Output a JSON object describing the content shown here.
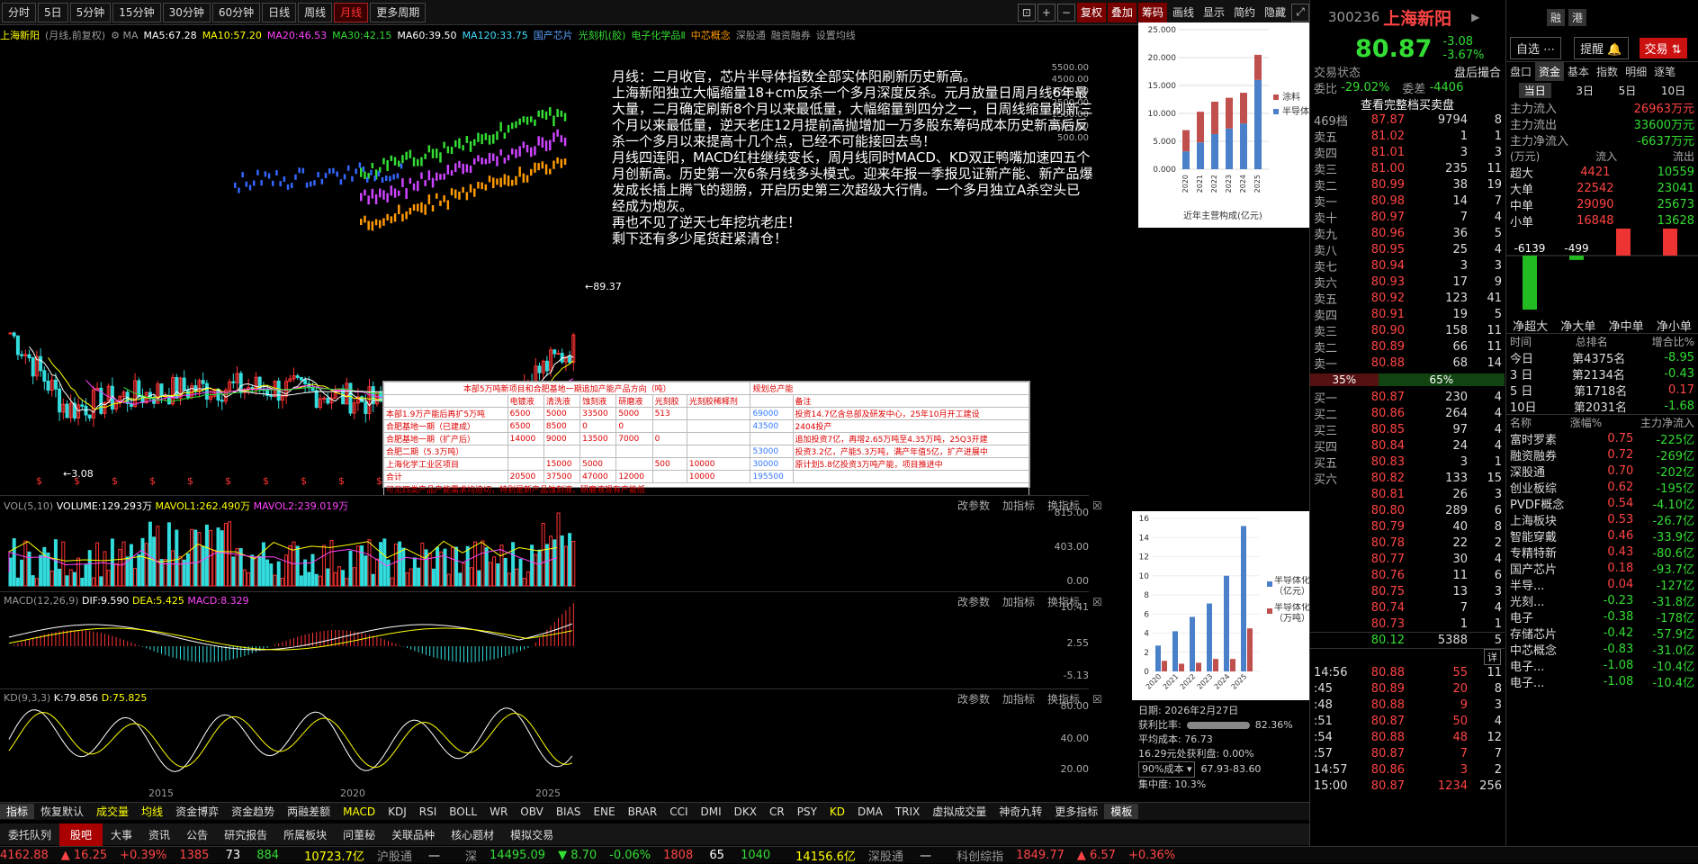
{
  "toolbar": {
    "periods": [
      "分时",
      "5日",
      "5分钟",
      "15分钟",
      "30分钟",
      "60分钟",
      "日线",
      "周线",
      "月线",
      "更多周期"
    ],
    "active_period": "月线",
    "right_buttons": [
      "复权",
      "叠加",
      "筹码",
      "画线",
      "显示",
      "简约",
      "隐藏"
    ]
  },
  "ma_line": {
    "name": "上海新阳",
    "mode": "(月线,前复权)",
    "ma5": "MA5:67.28",
    "ma10": "MA10:57.20",
    "ma20": "MA20:46.53",
    "ma30": "MA30:42.15",
    "ma60": "MA60:39.50",
    "ma120": "MA120:33.75",
    "tags": [
      "国产芯片",
      "光刻机(胶)",
      "电子化学品Ⅱ",
      "中芯概念"
    ],
    "links": [
      "深股通",
      "融资融券",
      "设置均线"
    ]
  },
  "annotation": "月线：二月收官，芯片半导体指数全部实体阳刷新历史新高。\n上海新阳独立大幅缩量18+cm反杀一个多月深度反杀。元月放量日周月线6年最大量，二月确定刷新8个月以来最低量，大幅缩量到四分之一，日周线缩量刷新三个月以来最低量，逆天老庄12月提前高抛增加一万多股东筹码成本历史新高后反杀一个多月以来提高十几个点，已经不可能接回去鸟！\n月线四连阳，MACD红柱继续变长，周月线同时MACD、KD双正鸭嘴加速四五个月创新高。历史第一次6条月线多头模式。迎来年报一季报见证新产能、新产品爆发成长插上腾飞的翅膀，开启历史第三次超级大行情。一个多月独立A杀空头已经成为炮灰。\n再也不见了逆天七年挖坑老庄！\n剩下还有多少尾货赶紧清仓！",
  "price_marks": {
    "high": "89.37",
    "low": "3.08"
  },
  "main_yaxis": [
    "5500.00",
    "4500.00",
    "3500.00",
    "2500.00",
    "1500.00",
    "1000.00",
    "500.00"
  ],
  "xaxis": [
    "2015",
    "2020",
    "2025"
  ],
  "table": {
    "title": "本部5万吨新项目和合肥基地一期追加产能产品方向（吨）",
    "title2": "规划总产能",
    "headers": [
      "",
      "电镀液",
      "清洗液",
      "蚀刻液",
      "研磨液",
      "光刻胶",
      "光刻胶稀释剂",
      "",
      "备注"
    ],
    "rows": [
      [
        "本部1.9万产能后再扩5万吨",
        "6500",
        "5000",
        "33500",
        "5000",
        "513",
        "",
        "69000",
        "投资14.7亿含总部及研发中心，25年10月开工建设"
      ],
      [
        "合肥基地一期（已建成）",
        "6500",
        "8500",
        "0",
        "0",
        "",
        "",
        "43500",
        "2404投产"
      ],
      [
        "合肥基地一期（扩产后）",
        "14000",
        "9000",
        "13500",
        "7000",
        "0",
        "",
        "",
        "追加投资7亿，再增2.65万吨至4.35万吨，25Q3开建"
      ],
      [
        "合肥二期（5.3万吨）",
        "",
        "",
        "",
        "",
        "",
        "",
        "53000",
        "投资3.2亿，产能5.3万吨，满产年值5亿，扩产进展中"
      ],
      [
        "上海化学工业区项目",
        "",
        "15000",
        "5000",
        "",
        "500",
        "10000",
        "30000",
        "原计划5.8亿投资3万吨产能，项目推进中"
      ],
      [
        "合计",
        "20500",
        "37500",
        "47000",
        "12000",
        "",
        "10000",
        "195500",
        ""
      ]
    ],
    "footer": "可见四类产品产能需求均迫切，特别是新产品蚀刻液、研磨液现有产能低"
  },
  "vol": {
    "label": "VOL(5,10)",
    "volume": "VOLUME:129.293万",
    "mavol1": "MAVOL1:262.490万",
    "mavol2": "MAVOL2:239.019万",
    "yaxis": [
      "815.00",
      "403.00",
      "0.00"
    ]
  },
  "macd": {
    "label": "MACD(12,26,9)",
    "dif": "DIF:9.590",
    "dea": "DEA:5.425",
    "macd": "MACD:8.329",
    "yaxis": [
      "10.41",
      "2.55",
      "-5.13"
    ]
  },
  "kd": {
    "label": "KD(9,3,3)",
    "k": "K:79.856",
    "d": "D:75.825",
    "yaxis": [
      "80.00",
      "40.00",
      "20.00"
    ]
  },
  "panel_tools": [
    "改参数",
    "加指标",
    "换指标"
  ],
  "info_box": {
    "date": "日期: 2026年2月27日",
    "profit_ratio_label": "获利比率:",
    "profit_ratio": "82.36%",
    "avg_cost": "平均成本: 76.73",
    "profit_at": "16.29元处获利盘: 0.00%",
    "cost_select": "90%成本",
    "cost_range": "67.93-83.60",
    "concentration": "集中度: 10.3%"
  },
  "mini1": {
    "yaxis": [
      "25.000",
      "20.000",
      "15.000",
      "10.000",
      "5.000",
      "0.000"
    ],
    "years": [
      "2020",
      "2021",
      "2022",
      "2023",
      "2024",
      "2025"
    ],
    "legend1": "涂料",
    "legend2": "半导体",
    "caption": "近年主营构成(亿元)"
  },
  "mini2": {
    "yaxis": [
      "16",
      "14",
      "12",
      "10",
      "8",
      "6",
      "4",
      "2",
      "0"
    ],
    "years": [
      "2020",
      "2021",
      "2022",
      "2023",
      "2024",
      "2025"
    ],
    "legend1": "半导体化学品营收（亿元）",
    "legend2": "半导体化学品产出（万吨）"
  },
  "chart_data": [
    {
      "type": "bar",
      "title": "近年主营构成(亿元)",
      "categories": [
        "2020",
        "2021",
        "2022",
        "2023",
        "2024",
        "2025"
      ],
      "series": [
        {
          "name": "半导体",
          "values": [
            3.2,
            4.8,
            6.3,
            7.3,
            8.2,
            16.0
          ]
        },
        {
          "name": "涂料",
          "values": [
            3.8,
            5.5,
            5.8,
            5.5,
            5.5,
            4.5
          ]
        }
      ],
      "ylim": [
        0,
        25
      ]
    },
    {
      "type": "bar",
      "title": "",
      "categories": [
        "2020",
        "2021",
        "2022",
        "2023",
        "2024",
        "2025"
      ],
      "series": [
        {
          "name": "半导体化学品营收（亿元）",
          "values": [
            2.7,
            4.2,
            5.7,
            7.1,
            10.0,
            15.2
          ]
        },
        {
          "name": "半导体化学品产出（万吨）",
          "values": [
            1.1,
            0.8,
            0.9,
            1.3,
            1.3,
            4.5
          ]
        }
      ],
      "ylim": [
        0,
        16
      ]
    }
  ],
  "stock": {
    "code": "300236",
    "name": "上海新阳",
    "price": "80.87",
    "change": "-3.08",
    "change_pct": "-3.67%",
    "status_label": "交易状态",
    "status_value": "盘后撮合",
    "weibi_label": "委比",
    "weibi": "-29.02%",
    "weicha_label": "委差",
    "weicha": "-4406",
    "view_all": "查看完整档买卖盘",
    "top_row": {
      "level": "469档",
      "price": "87.87",
      "vol": "9794",
      "n": "8"
    }
  },
  "sells": [
    {
      "l": "卖五",
      "p": "81.02",
      "v": "1",
      "n": "1"
    },
    {
      "l": "卖四",
      "p": "81.01",
      "v": "3",
      "n": "3"
    },
    {
      "l": "卖三",
      "p": "81.00",
      "v": "235",
      "n": "11"
    },
    {
      "l": "卖二",
      "p": "80.99",
      "v": "38",
      "n": "19"
    },
    {
      "l": "卖一",
      "p": "80.98",
      "v": "14",
      "n": "7"
    },
    {
      "l": "卖十",
      "p": "80.97",
      "v": "7",
      "n": "4"
    },
    {
      "l": "卖九",
      "p": "80.96",
      "v": "36",
      "n": "5"
    },
    {
      "l": "卖八",
      "p": "80.95",
      "v": "25",
      "n": "4"
    },
    {
      "l": "卖七",
      "p": "80.94",
      "v": "3",
      "n": "3"
    },
    {
      "l": "卖六",
      "p": "80.93",
      "v": "17",
      "n": "9"
    },
    {
      "l": "卖五",
      "p": "80.92",
      "v": "123",
      "n": "41"
    },
    {
      "l": "卖四",
      "p": "80.91",
      "v": "19",
      "n": "5"
    },
    {
      "l": "卖三",
      "p": "80.90",
      "v": "158",
      "n": "11"
    },
    {
      "l": "卖二",
      "p": "80.89",
      "v": "66",
      "n": "11"
    },
    {
      "l": "卖一",
      "p": "80.88",
      "v": "68",
      "n": "14"
    }
  ],
  "ratio": {
    "left": "35%",
    "right": "65%",
    "left_pct": 0.35
  },
  "buys": [
    {
      "l": "买一",
      "p": "80.87",
      "v": "230",
      "n": "4"
    },
    {
      "l": "买二",
      "p": "80.86",
      "v": "264",
      "n": "4"
    },
    {
      "l": "买三",
      "p": "80.85",
      "v": "97",
      "n": "4"
    },
    {
      "l": "买四",
      "p": "80.84",
      "v": "24",
      "n": "4"
    },
    {
      "l": "买五",
      "p": "80.83",
      "v": "3",
      "n": "1"
    },
    {
      "l": "买六",
      "p": "80.82",
      "v": "133",
      "n": "15"
    },
    {
      "l": "",
      "p": "80.81",
      "v": "26",
      "n": "3"
    },
    {
      "l": "",
      "p": "80.80",
      "v": "289",
      "n": "6"
    },
    {
      "l": "",
      "p": "80.79",
      "v": "40",
      "n": "8"
    },
    {
      "l": "",
      "p": "80.78",
      "v": "22",
      "n": "2"
    },
    {
      "l": "",
      "p": "80.77",
      "v": "30",
      "n": "4"
    },
    {
      "l": "",
      "p": "80.76",
      "v": "11",
      "n": "6"
    },
    {
      "l": "",
      "p": "80.75",
      "v": "13",
      "n": "3"
    },
    {
      "l": "",
      "p": "80.74",
      "v": "7",
      "n": "4"
    },
    {
      "l": "",
      "p": "80.73",
      "v": "1",
      "n": "1"
    }
  ],
  "bottom_row": {
    "p": "80.12",
    "v": "5388",
    "n": "5"
  },
  "ticks_label": "详",
  "ticks": [
    {
      "t": "14:56",
      "p": "80.88",
      "v": "55",
      "n": "11"
    },
    {
      "t": ":45",
      "p": "80.89",
      "v": "20",
      "n": "8"
    },
    {
      "t": ":48",
      "p": "80.88",
      "v": "9",
      "n": "3"
    },
    {
      "t": ":51",
      "p": "80.87",
      "v": "50",
      "n": "4"
    },
    {
      "t": ":54",
      "p": "80.88",
      "v": "48",
      "n": "12"
    },
    {
      "t": ":57",
      "p": "80.87",
      "v": "7",
      "n": "7"
    },
    {
      "t": "14:57",
      "p": "80.86",
      "v": "3",
      "n": "2"
    },
    {
      "t": "15:00",
      "p": "80.87",
      "v": "1234",
      "n": "256"
    }
  ],
  "fpanel": {
    "top_tags": [
      "融",
      "港"
    ],
    "select": "自选",
    "remind": "提醒",
    "trade": "交易",
    "tabs": [
      "盘口",
      "资金",
      "基本",
      "指数",
      "明细",
      "逐笔"
    ],
    "subtabs": [
      "当日",
      "3日",
      "5日",
      "10日"
    ],
    "flows": [
      {
        "k": "主力流入",
        "v": "26963万元",
        "c": "red"
      },
      {
        "k": "主力流出",
        "v": "33600万元",
        "c": "green"
      },
      {
        "k": "主力净流入",
        "v": "-6637万元",
        "c": "green"
      }
    ],
    "unit": "(万元)",
    "in_label": "流入",
    "out_label": "流出",
    "orders": [
      {
        "k": "超大",
        "in": "4421",
        "out": "10559"
      },
      {
        "k": "大单",
        "in": "22542",
        "out": "23041"
      },
      {
        "k": "中单",
        "in": "29090",
        "out": "25673"
      },
      {
        "k": "小单",
        "in": "16848",
        "out": "13628"
      }
    ],
    "net_bars": [
      {
        "label": "净超大",
        "value": "-6139"
      },
      {
        "label": "净大单",
        "value": "-499"
      },
      {
        "label": "净中单",
        "value": "3417"
      },
      {
        "label": "净小单",
        "value": "3220"
      }
    ],
    "rank_head": [
      "时间",
      "总排名",
      "增合比%"
    ],
    "ranks": [
      {
        "t": "今日",
        "r": "第4375名",
        "v": "-8.95"
      },
      {
        "t": "3 日",
        "r": "第2134名",
        "v": "-0.43"
      },
      {
        "t": "5 日",
        "r": "第1718名",
        "v": "0.17"
      },
      {
        "t": "10日",
        "r": "第2031名",
        "v": "-1.68"
      }
    ],
    "sector_head": [
      "名称",
      "涨幅%",
      "主力净流入"
    ],
    "sectors": [
      {
        "n": "富时罗素",
        "p": "0.75",
        "f": "-225亿"
      },
      {
        "n": "融资融券",
        "p": "0.72",
        "f": "-269亿"
      },
      {
        "n": "深股通",
        "p": "0.70",
        "f": "-202亿"
      },
      {
        "n": "创业板综",
        "p": "0.62",
        "f": "-195亿"
      },
      {
        "n": "PVDF概念",
        "p": "0.54",
        "f": "-4.10亿"
      },
      {
        "n": "上海板块",
        "p": "0.53",
        "f": "-26.7亿"
      },
      {
        "n": "智能穿戴",
        "p": "0.46",
        "f": "-33.9亿"
      },
      {
        "n": "专精特新",
        "p": "0.43",
        "f": "-80.6亿"
      },
      {
        "n": "国产芯片",
        "p": "0.18",
        "f": "-93.7亿"
      },
      {
        "n": "半导...",
        "p": "0.04",
        "f": "-127亿"
      },
      {
        "n": "光刻...",
        "p": "-0.23",
        "f": "-31.8亿"
      },
      {
        "n": "电子",
        "p": "-0.38",
        "f": "-178亿"
      },
      {
        "n": "存储芯片",
        "p": "-0.42",
        "f": "-57.9亿"
      },
      {
        "n": "中芯概念",
        "p": "-0.83",
        "f": "-31.0亿"
      },
      {
        "n": "电子...",
        "p": "-1.08",
        "f": "-10.4亿"
      },
      {
        "n": "电子...",
        "p": "-1.08",
        "f": "-10.4亿"
      }
    ]
  },
  "indicator_bar": [
    "指标",
    "恢复默认",
    "成交量",
    "均线",
    "资金博弈",
    "资金趋势",
    "两融差额",
    "MACD",
    "KDJ",
    "RSI",
    "BOLL",
    "WR",
    "OBV",
    "BIAS",
    "ENE",
    "BRAR",
    "CCI",
    "DMI",
    "DKX",
    "CR",
    "PSY",
    "KD",
    "DMA",
    "TRIX",
    "虚拟成交量",
    "神奇九转",
    "更多指标",
    "模板"
  ],
  "tabbar": [
    "委托队列",
    "股吧",
    "大事",
    "资讯",
    "公告",
    "研究报告",
    "所属板块",
    "问董秘",
    "关联品种",
    "核心题材",
    "模拟交易"
  ],
  "tabbar_active": "股吧",
  "ticker": {
    "sh": "4162.88",
    "sh_chg": "▲ 16.25",
    "sh_pct": "+0.39%",
    "sh_up": "1385",
    "sh_flat": "73",
    "sh_down": "884",
    "sh_amt": "10723.7亿",
    "hgt": "沪股通",
    "hgt_v": "一",
    "sz_label": "深",
    "sz": "14495.09",
    "sz_chg": "▼ 8.70",
    "sz_pct": "-0.06%",
    "sz_up": "1808",
    "sz_flat": "65",
    "sz_down": "1040",
    "sz_amt": "14156.6亿",
    "sgt": "深股通",
    "sgt_v": "一",
    "kc": "科创综指",
    "kc_v": "1849.77",
    "kc_chg": "▲ 6.57",
    "kc_pct": "+0.36%"
  }
}
